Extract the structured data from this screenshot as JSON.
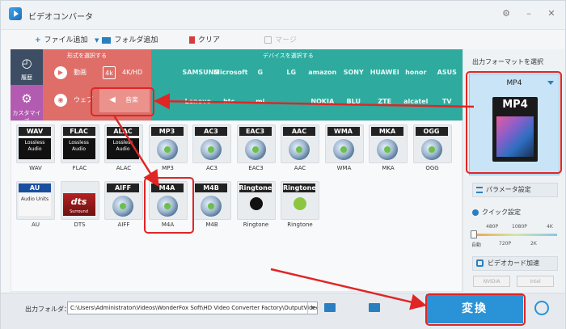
{
  "window": {
    "title": "ビデオコンバータ",
    "controls": [
      "settings-icon",
      "minimize-icon",
      "close-icon"
    ]
  },
  "toolbar": {
    "add_file": "ファイル追加",
    "add_folder": "フォルダ追加",
    "clear": "クリア",
    "merge": "マージ"
  },
  "sidebar": {
    "history": "履歴",
    "customize": "カスタマイズ"
  },
  "format_band": {
    "caption": "形式を選択する",
    "categories": [
      {
        "label": "動画",
        "icon": "play-icon"
      },
      {
        "label": "4K/HD",
        "icon": "4k-icon"
      },
      {
        "label": "ウェブ",
        "icon": "chrome-icon"
      },
      {
        "label": "音楽",
        "icon": "speaker-icon",
        "selected": true
      }
    ]
  },
  "device_band": {
    "caption": "デバイスを選択する",
    "brands_row1": [
      "",
      "SAMSUNG",
      "Microsoft",
      "G",
      "LG",
      "amazon",
      "SONY",
      "HUAWEI",
      "honor",
      "ASUS"
    ],
    "brands_row2": [
      "",
      "Lenovo",
      "htc",
      "mi",
      "",
      "NOKIA",
      "BLU",
      "ZTE",
      "alcatel",
      "TV"
    ]
  },
  "formats": [
    {
      "name": "WAV",
      "style": "lossless",
      "label": "WAV"
    },
    {
      "name": "FLAC",
      "style": "lossless",
      "label": "FLAC"
    },
    {
      "name": "ALAC",
      "style": "lossless",
      "label": "ALAC"
    },
    {
      "name": "MP3",
      "style": "disc",
      "label": "MP3"
    },
    {
      "name": "AC3",
      "style": "disc",
      "label": "AC3"
    },
    {
      "name": "EAC3",
      "style": "disc",
      "label": "EAC3"
    },
    {
      "name": "AAC",
      "style": "disc",
      "label": "AAC"
    },
    {
      "name": "WMA",
      "style": "disc",
      "label": "WMA"
    },
    {
      "name": "MKA",
      "style": "disc",
      "label": "MKA"
    },
    {
      "name": "OGG",
      "style": "disc",
      "label": "OGG"
    },
    {
      "name": "AU",
      "style": "au",
      "label": "AU"
    },
    {
      "name": "dts",
      "style": "dts",
      "label": "DTS"
    },
    {
      "name": "AIFF",
      "style": "disc",
      "label": "AIFF"
    },
    {
      "name": "M4A",
      "style": "disc",
      "label": "M4A",
      "highlighted": true
    },
    {
      "name": "M4B",
      "style": "disc",
      "label": "M4B"
    },
    {
      "name": "Ringtone",
      "style": "apple",
      "label": "Ringtone"
    },
    {
      "name": "Ringtone",
      "style": "android",
      "label": "Ringtone"
    }
  ],
  "format_texts": {
    "lossless": "Lossless Audio",
    "au_sub": "Audio Units",
    "dts_sub": "Surround"
  },
  "right_panel": {
    "output_label": "出力フォーマットを選択",
    "selected_format": "MP4",
    "icon_text": "MP4",
    "param_button": "パラメータ設定",
    "quick_label": "クイック設定",
    "quality_top": [
      "480P",
      "1080P",
      "4K"
    ],
    "quality_bottom": [
      "自動",
      "720P",
      "2K"
    ],
    "gpu_button": "ビデオカード加速",
    "gpu_chips": [
      "NVIDIA",
      "Intel"
    ]
  },
  "bottom": {
    "folder_label": "出力フォルダ：",
    "path": "C:\\Users\\Administrator\\Videos\\WonderFox Soft\\HD Video Converter Factory\\OutputVideo",
    "convert": "変換"
  },
  "colors": {
    "format_band": "#de6e67",
    "device_band": "#2eaa9e",
    "sidebar": "#3c4d64",
    "accent": "#2a92d6",
    "annotation": "#e02525"
  }
}
